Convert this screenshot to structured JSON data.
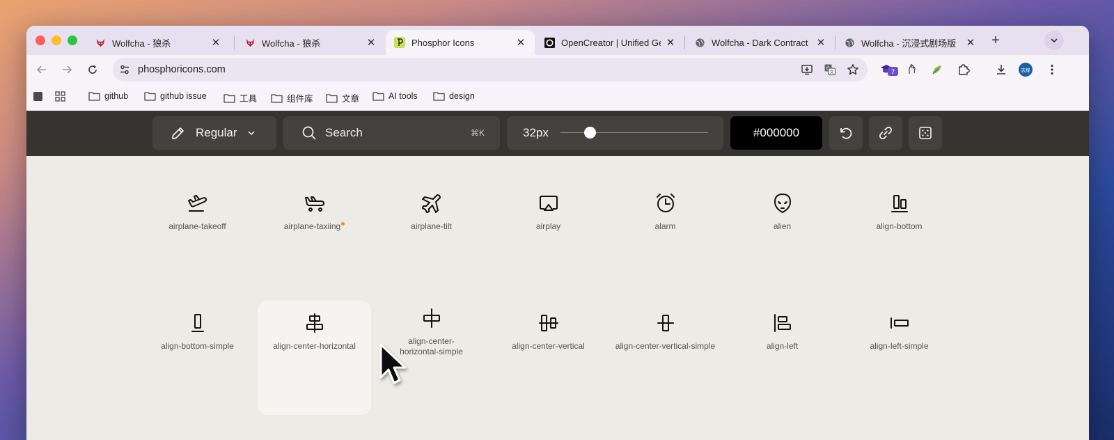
{
  "tabs": [
    {
      "title": "Wolfcha - 狼杀",
      "icon": "wolf-favicon-icon",
      "active": false
    },
    {
      "title": "Wolfcha - 狼杀",
      "icon": "wolf-favicon-icon",
      "active": false
    },
    {
      "title": "Phosphor Icons",
      "icon": "phosphor-favicon-icon",
      "active": true
    },
    {
      "title": "OpenCreator | Unified Ge",
      "icon": "opencreator-favicon-icon",
      "active": false
    },
    {
      "title": "Wolfcha - Dark Contract",
      "icon": "globe-icon",
      "active": false
    },
    {
      "title": "Wolfcha - 沉浸式剧场版",
      "icon": "globe-icon",
      "active": false
    }
  ],
  "address_bar": {
    "url": "phosphoricons.com"
  },
  "extensions": {
    "badge_count": "7"
  },
  "profile": {
    "avatar_text": "志煌"
  },
  "bookmarks": [
    "github",
    "github issue",
    "工具",
    "组件库",
    "文章",
    "AI tools",
    "design"
  ],
  "phosphor_toolbar": {
    "weight_label": "Regular",
    "search_placeholder": "Search",
    "search_shortcut": "⌘K",
    "size_label": "32px",
    "size_slider_fraction": 0.2,
    "color_value": "#000000"
  },
  "icons": [
    {
      "name": "airplane-takeoff",
      "new": false
    },
    {
      "name": "airplane-taxiing",
      "new": true
    },
    {
      "name": "airplane-tilt",
      "new": false
    },
    {
      "name": "airplay",
      "new": false
    },
    {
      "name": "alarm",
      "new": false
    },
    {
      "name": "alien",
      "new": false
    },
    {
      "name": "align-bottom",
      "new": false
    },
    {
      "name": "align-bottom-simple",
      "new": false
    },
    {
      "name": "align-center-horizontal",
      "new": false
    },
    {
      "name": "align-center-horizontal-simple",
      "new": false
    },
    {
      "name": "align-center-vertical",
      "new": false
    },
    {
      "name": "align-center-vertical-simple",
      "new": false
    },
    {
      "name": "align-left",
      "new": false
    },
    {
      "name": "align-left-simple",
      "new": false
    }
  ],
  "colors": {
    "new_dot": "#d9a021",
    "toolbar_bg": "#353431",
    "grid_bg": "#ecebe6"
  }
}
